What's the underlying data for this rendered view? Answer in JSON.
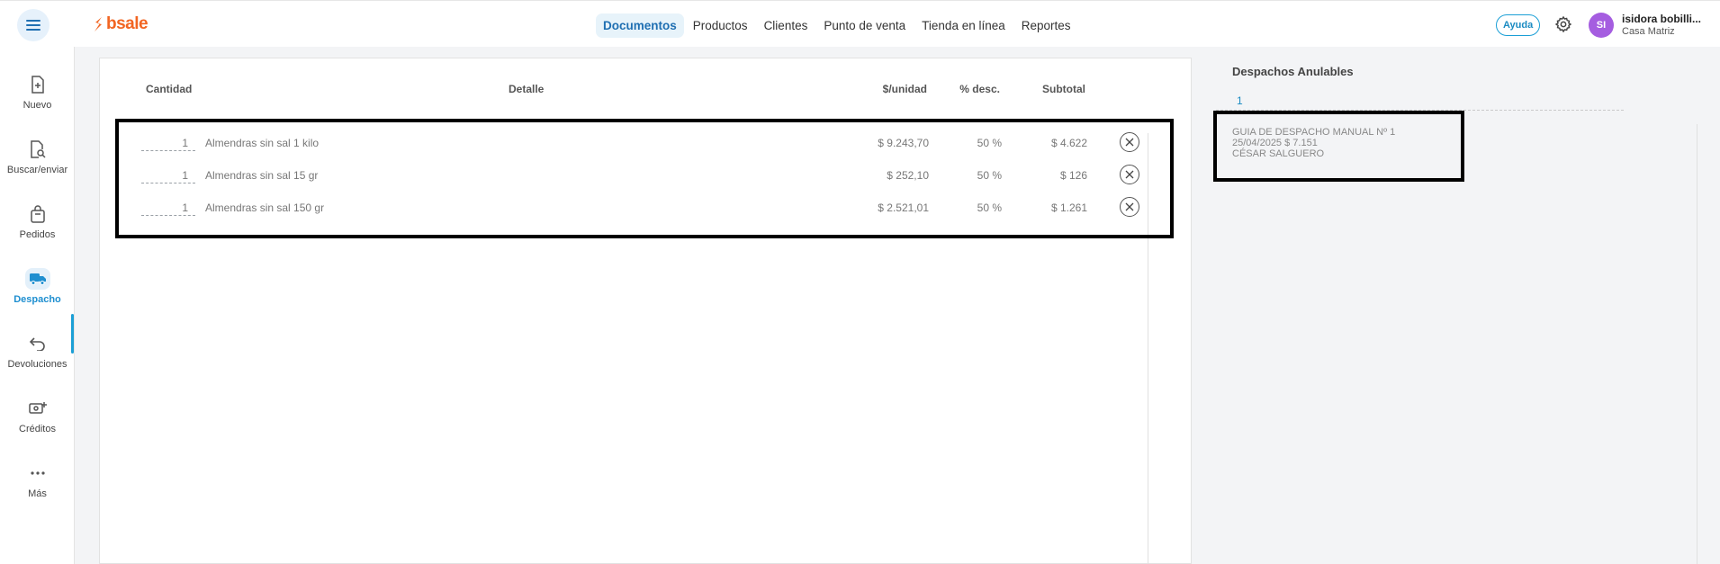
{
  "header": {
    "brand": "bsale",
    "brand_color": "#f26522",
    "nav": [
      {
        "label": "Documentos",
        "active": true
      },
      {
        "label": "Productos",
        "active": false
      },
      {
        "label": "Clientes",
        "active": false
      },
      {
        "label": "Punto de venta",
        "active": false
      },
      {
        "label": "Tienda en línea",
        "active": false
      },
      {
        "label": "Reportes",
        "active": false
      }
    ],
    "help_label": "Ayuda",
    "user": {
      "initials": "SI",
      "name": "isidora bobilli...",
      "branch": "Casa Matriz",
      "avatar_color": "#a55de0"
    }
  },
  "sidebar": {
    "items": [
      {
        "label": "Nuevo",
        "icon": "new-document-icon",
        "active": false
      },
      {
        "label": "Buscar/enviar",
        "icon": "search-document-icon",
        "active": false
      },
      {
        "label": "Pedidos",
        "icon": "shopping-bag-icon",
        "active": false
      },
      {
        "label": "Despacho",
        "icon": "truck-icon",
        "active": true
      },
      {
        "label": "Devoluciones",
        "icon": "return-arrow-icon",
        "active": false
      },
      {
        "label": "Créditos",
        "icon": "money-plus-icon",
        "active": false
      },
      {
        "label": "Más",
        "icon": "more-dots-icon",
        "active": false
      }
    ],
    "accent": "#1b9fd6"
  },
  "table": {
    "headers": {
      "quantity": "Cantidad",
      "detail": "Detalle",
      "unit_price": "$/unidad",
      "discount": "% desc.",
      "subtotal": "Subtotal"
    },
    "rows": [
      {
        "quantity": "1",
        "detail": "Almendras sin sal 1 kilo",
        "unit_price": "$ 9.243,70",
        "discount": "50 %",
        "subtotal": "$ 4.622"
      },
      {
        "quantity": "1",
        "detail": "Almendras sin sal 15 gr",
        "unit_price": "$ 252,10",
        "discount": "50 %",
        "subtotal": "$ 126"
      },
      {
        "quantity": "1",
        "detail": "Almendras sin sal 150 gr",
        "unit_price": "$ 2.521,01",
        "discount": "50 %",
        "subtotal": "$ 1.261"
      }
    ]
  },
  "right_panel": {
    "title": "Despachos Anulables",
    "tab": "1",
    "dispatch": {
      "line1": "GUIA DE DESPACHO MANUAL Nº 1",
      "line2": "25/04/2025 $ 7.151",
      "line3": "CÉSAR SALGUERO"
    }
  }
}
